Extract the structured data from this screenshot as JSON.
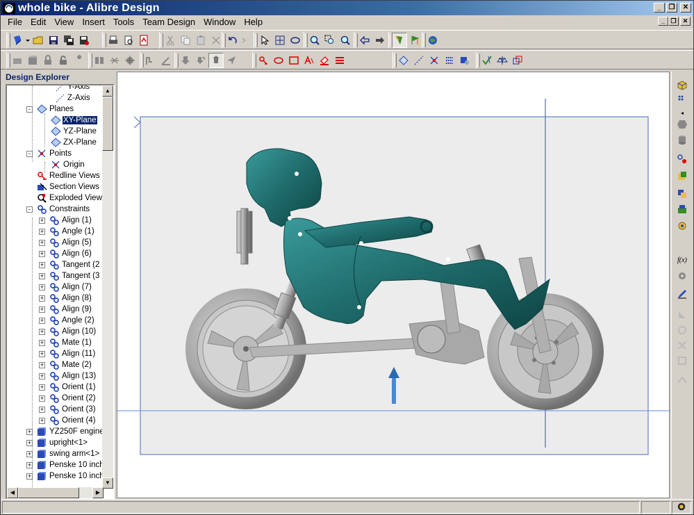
{
  "window": {
    "title": "whole bike - Alibre Design"
  },
  "menu": [
    "File",
    "Edit",
    "View",
    "Insert",
    "Tools",
    "Team Design",
    "Window",
    "Help"
  ],
  "explorer": {
    "title": "Design Explorer",
    "items": [
      {
        "label": "Y-Axis",
        "icon": "axis-icon"
      },
      {
        "label": "Z-Axis",
        "icon": "axis-icon"
      },
      {
        "label": "Planes",
        "icon": "plane-icon"
      },
      {
        "label": "XY-Plane",
        "icon": "plane-icon",
        "selected": true
      },
      {
        "label": "YZ-Plane",
        "icon": "plane-icon"
      },
      {
        "label": "ZX-Plane",
        "icon": "plane-icon"
      },
      {
        "label": "Points",
        "icon": "point-icon"
      },
      {
        "label": "Origin",
        "icon": "point-icon"
      },
      {
        "label": "Redline Views",
        "icon": "redline-icon"
      },
      {
        "label": "Section Views",
        "icon": "section-icon"
      },
      {
        "label": "Exploded Views",
        "icon": "exploded-icon"
      },
      {
        "label": "Constraints",
        "icon": "constraint-icon"
      },
      {
        "label": "Align (1)",
        "icon": "constraint-icon"
      },
      {
        "label": "Angle (1)",
        "icon": "constraint-icon"
      },
      {
        "label": "Align (5)",
        "icon": "constraint-icon"
      },
      {
        "label": "Align (6)",
        "icon": "constraint-icon"
      },
      {
        "label": "Tangent (2",
        "icon": "constraint-icon"
      },
      {
        "label": "Tangent (3",
        "icon": "constraint-icon"
      },
      {
        "label": "Align (7)",
        "icon": "constraint-icon"
      },
      {
        "label": "Align (8)",
        "icon": "constraint-icon"
      },
      {
        "label": "Align (9)",
        "icon": "constraint-icon"
      },
      {
        "label": "Angle (2)",
        "icon": "constraint-icon"
      },
      {
        "label": "Align (10)",
        "icon": "constraint-icon"
      },
      {
        "label": "Mate (1)",
        "icon": "constraint-icon"
      },
      {
        "label": "Align (11)",
        "icon": "constraint-icon"
      },
      {
        "label": "Mate (2)",
        "icon": "constraint-icon"
      },
      {
        "label": "Align (13)",
        "icon": "constraint-icon"
      },
      {
        "label": "Orient (1)",
        "icon": "constraint-icon"
      },
      {
        "label": "Orient (2)",
        "icon": "constraint-icon"
      },
      {
        "label": "Orient (3)",
        "icon": "constraint-icon"
      },
      {
        "label": "Orient (4)",
        "icon": "constraint-icon"
      },
      {
        "label": "YZ250F engine",
        "icon": "part-icon"
      },
      {
        "label": "upright<1>",
        "icon": "part-icon"
      },
      {
        "label": "swing arm<1>",
        "icon": "part-icon"
      },
      {
        "label": "Penske 10 inch",
        "icon": "part-icon"
      },
      {
        "label": "Penske 10 inch",
        "icon": "part-icon"
      }
    ]
  },
  "colors": {
    "accent": "#0a246a",
    "model_body": "#1f6b6b",
    "model_parts": "#a9a9a9",
    "workspace": "#ececec"
  }
}
